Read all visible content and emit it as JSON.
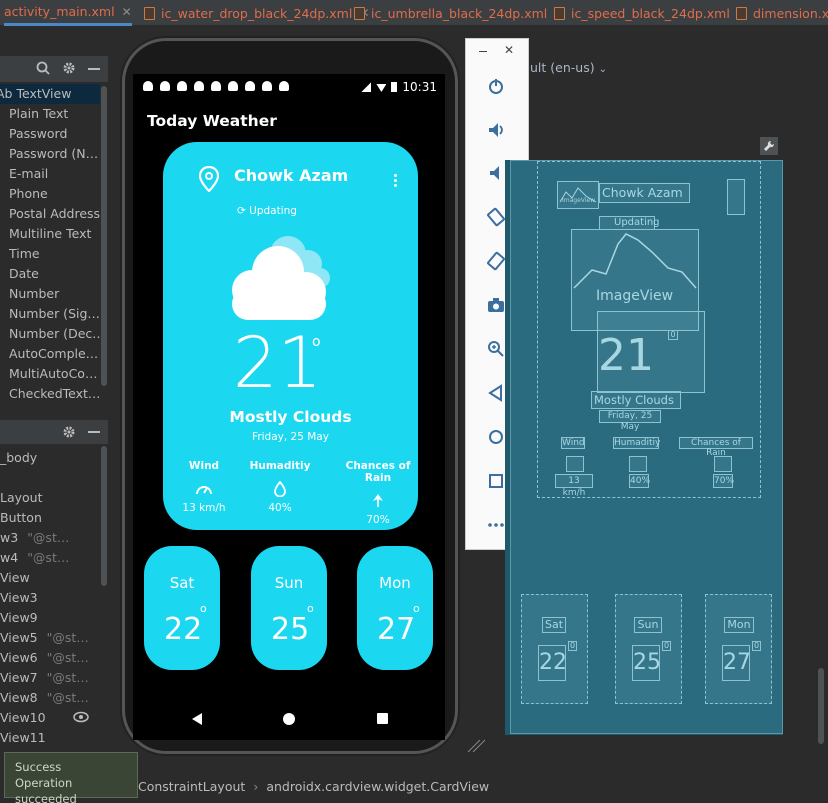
{
  "tabs": [
    {
      "label": "activity_main.xml",
      "active": true
    },
    {
      "label": "ic_water_drop_black_24dp.xml",
      "active": false
    },
    {
      "label": "ic_umbrella_black_24dp.xml",
      "active": false
    },
    {
      "label": "ic_speed_black_24dp.xml",
      "active": false
    },
    {
      "label": "dimension.xml",
      "active": false
    }
  ],
  "palette": {
    "items": [
      "TextView",
      "Plain Text",
      "Password",
      "Password (N…",
      "E-mail",
      "Phone",
      "Postal Address",
      "Multiline Text",
      "Time",
      "Date",
      "Number",
      "Number (Sig…",
      "Number (Dec…",
      "AutoComple…",
      "MultiAutoCo…",
      "CheckedText…"
    ],
    "first_prefix": "Ab"
  },
  "component_tree": {
    "items": [
      {
        "label": "_body",
        "muted": ""
      },
      {
        "label": "",
        "muted": ""
      },
      {
        "label": "Layout",
        "muted": ""
      },
      {
        "label": "Button",
        "muted": ""
      },
      {
        "label": "w3",
        "muted": "\"@st…"
      },
      {
        "label": "w4",
        "muted": "\"@st…"
      },
      {
        "label": "View",
        "muted": ""
      },
      {
        "label": "View3",
        "muted": ""
      },
      {
        "label": "View9",
        "muted": ""
      },
      {
        "label": "View5",
        "muted": "\"@st…"
      },
      {
        "label": "View6",
        "muted": "\"@st…"
      },
      {
        "label": "View7",
        "muted": "\"@st…"
      },
      {
        "label": "View8",
        "muted": "\"@st…"
      },
      {
        "label": "View10",
        "muted": ""
      },
      {
        "label": "View11",
        "muted": ""
      }
    ]
  },
  "phone": {
    "status_time": "10:31",
    "app_title": "Today Weather",
    "card": {
      "city": "Chowk Azam",
      "updating": "Updating",
      "temperature": "21",
      "degree_symbol": "o",
      "condition": "Mostly Clouds",
      "date": "Friday, 25 May",
      "metrics": [
        {
          "label": "Wind",
          "value": "13 km/h",
          "icon": "speed-icon"
        },
        {
          "label": "Humaditiy",
          "value": "40%",
          "icon": "water-drop-icon"
        },
        {
          "label": "Chances of Rain",
          "value": "70%",
          "icon": "umbrella-icon"
        }
      ]
    },
    "forecast": [
      {
        "day": "Sat",
        "temp": "22",
        "deg": "o"
      },
      {
        "day": "Sun",
        "temp": "25",
        "deg": "o"
      },
      {
        "day": "Mon",
        "temp": "27",
        "deg": "o"
      }
    ]
  },
  "emulator_toolbar": {
    "buttons": [
      "power-icon",
      "volume-up-icon",
      "volume-down-icon",
      "rotate-left-icon",
      "rotate-right-icon",
      "camera-icon",
      "zoom-icon",
      "back-icon",
      "home-icon",
      "overview-icon",
      "more-icon"
    ]
  },
  "design_surface": {
    "device_label": "ult (en-us)",
    "blueprint": {
      "city": "Chowk Azam",
      "updating": "Updating",
      "imageview_small": "ImageView",
      "imageview": "ImageView",
      "degree": "0",
      "temp": "21",
      "condition": "Mostly Clouds",
      "date": "Friday, 25 May",
      "metric_labels": [
        "Wind",
        "Humaditiy",
        "Chances of Rain"
      ],
      "metric_values": [
        "13 km/h",
        "40%",
        "70%"
      ],
      "days": [
        {
          "day": "Sat",
          "temp": "22",
          "deg": "0"
        },
        {
          "day": "Sun",
          "temp": "25",
          "deg": "0"
        },
        {
          "day": "Mon",
          "temp": "27",
          "deg": "0"
        }
      ]
    }
  },
  "toast": {
    "title": "Success",
    "message": "Operation succeeded"
  },
  "breadcrumb": [
    "ConstraintLayout",
    "androidx.cardview.widget.CardView"
  ],
  "colors": {
    "card": "#1bd7f0",
    "ide_bg": "#2b2b2b",
    "blueprint": "#2a6b80",
    "tab_text": "#e06c4b"
  }
}
